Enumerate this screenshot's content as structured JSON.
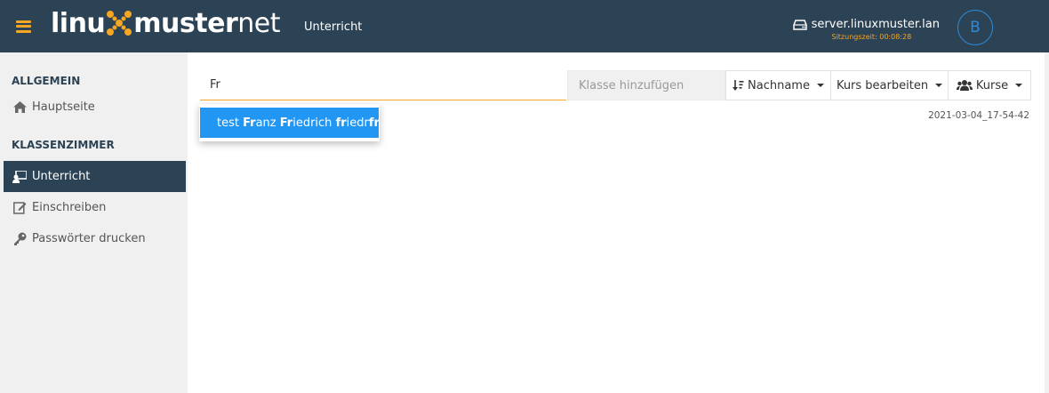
{
  "header": {
    "logo_part1": "linu",
    "logo_part2": "muster",
    "logo_part3": "net",
    "page_title": "Unterricht",
    "server_name": "server.linuxmuster.lan",
    "session_label": "Sitzungszeit: 00:08:28",
    "avatar_initial": "B",
    "accent_color": "#f5a623",
    "header_color": "#2c4255"
  },
  "sidebar": {
    "sections": [
      {
        "title": "ALLGEMEIN"
      },
      {
        "title": "KLASSENZIMMER"
      }
    ],
    "items": [
      {
        "label": "Hauptseite",
        "icon": "home-icon"
      },
      {
        "label": "Unterricht",
        "icon": "classroom-icon",
        "active": true
      },
      {
        "label": "Einschreiben",
        "icon": "edit-icon"
      },
      {
        "label": "Passwörter drucken",
        "icon": "key-icon"
      }
    ]
  },
  "toolbar": {
    "search_value": "Fr",
    "class_placeholder": "Klasse hinzufügen",
    "sort_label": "Nachname",
    "edit_label": "Kurs bearbeiten",
    "courses_label": "Kurse"
  },
  "timestamp": "2021-03-04_17-54-42",
  "suggestion": {
    "prefix": "test ",
    "m1": "Fr",
    "t1": "anz ",
    "m2": "Fr",
    "t2": "iedrich ",
    "m3": "fr",
    "t3": "iedr",
    "m4": "fr",
    "highlight_color": "#2196f3"
  }
}
